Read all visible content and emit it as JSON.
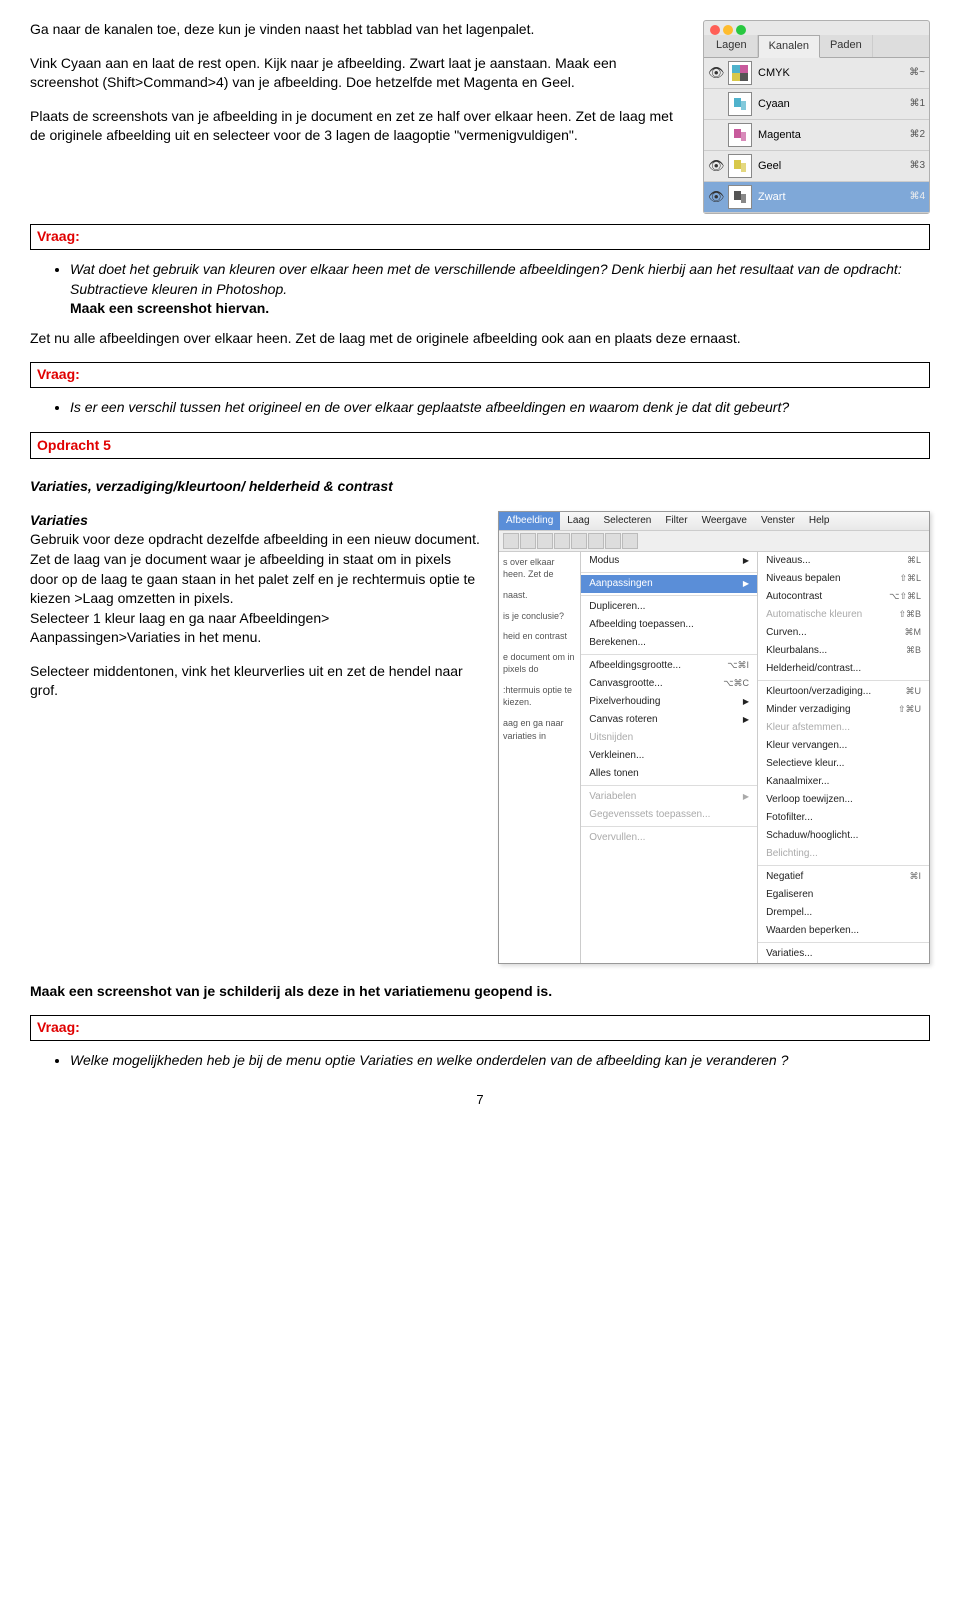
{
  "intro": {
    "p1": "Ga naar de kanalen toe, deze kun je vinden naast het tabblad van het lagenpalet.",
    "p2": "Vink Cyaan aan en laat de rest open. Kijk naar je afbeelding. Zwart laat je aanstaan. Maak een screenshot (Shift>Command>4) van je afbeelding. Doe hetzelfde met Magenta en Geel.",
    "p3": "Plaats de screenshots van je afbeelding in je document en zet ze half over elkaar heen. Zet de laag met de originele afbeelding uit en selecteer voor de 3 lagen de laagoptie \"vermenigvuldigen\"."
  },
  "channels_panel": {
    "tabs": [
      "Lagen",
      "Kanalen",
      "Paden"
    ],
    "rows": [
      {
        "label": "CMYK",
        "shortcut": "⌘~",
        "eye": true,
        "selected": false,
        "color": "mixed"
      },
      {
        "label": "Cyaan",
        "shortcut": "⌘1",
        "eye": false,
        "selected": false,
        "color": "#4fb2cc"
      },
      {
        "label": "Magenta",
        "shortcut": "⌘2",
        "eye": false,
        "selected": false,
        "color": "#c85a9c"
      },
      {
        "label": "Geel",
        "shortcut": "⌘3",
        "eye": true,
        "selected": false,
        "color": "#d8c84a"
      },
      {
        "label": "Zwart",
        "shortcut": "⌘4",
        "eye": true,
        "selected": true,
        "color": "#555"
      }
    ]
  },
  "vraag_label": "Vraag:",
  "vraag1": {
    "bullet_part1": "Wat doet het gebruik van kleuren over elkaar heen met de verschillende afbeeldingen? Denk hierbij aan het resultaat van de opdracht: Subtractieve kleuren in Photoshop.",
    "bullet_bold": "Maak een screenshot hiervan."
  },
  "mid_p": "Zet nu alle afbeeldingen over elkaar heen.  Zet de laag met de  originele afbeelding ook aan en plaats deze ernaast.",
  "vraag2_bullet": "Is er een verschil tussen het origineel en de over elkaar geplaatste afbeeldingen en waarom denk je dat dit gebeurt?",
  "opdracht5": "Opdracht 5",
  "sec_title": "Variaties, verzadiging/kleurtoon/  helderheid & contrast",
  "variaties": {
    "heading": "Variaties",
    "p1": "Gebruik voor deze opdracht dezelfde afbeelding in een nieuw document.",
    "p2": "Zet de laag van je document waar je afbeelding in staat om in pixels door op de laag te gaan staan in het palet zelf en je rechtermuis optie te kiezen >Laag omzetten in pixels.",
    "p3": "Selecteer 1 kleur laag en ga naar Afbeeldingen> Aanpassingen>Variaties in het menu.",
    "p4": "Selecteer middentonen, vink het kleurverlies uit en zet de hendel naar grof."
  },
  "menu": {
    "topbar": [
      "Afbeelding",
      "Laag",
      "Selecteren",
      "Filter",
      "Weergave",
      "Venster",
      "Help"
    ],
    "left": [
      {
        "label": "Modus",
        "arrow": true
      },
      {
        "sep": true
      },
      {
        "label": "Aanpassingen",
        "arrow": true,
        "sel": true
      },
      {
        "sep": true
      },
      {
        "label": "Dupliceren..."
      },
      {
        "label": "Afbeelding toepassen..."
      },
      {
        "label": "Berekenen..."
      },
      {
        "sep": true
      },
      {
        "label": "Afbeeldingsgrootte...",
        "shortcut": "⌥⌘I"
      },
      {
        "label": "Canvasgrootte...",
        "shortcut": "⌥⌘C"
      },
      {
        "label": "Pixelverhouding",
        "arrow": true
      },
      {
        "label": "Canvas roteren",
        "arrow": true
      },
      {
        "label": "Uitsnijden",
        "dis": true
      },
      {
        "label": "Verkleinen..."
      },
      {
        "label": "Alles tonen"
      },
      {
        "sep": true
      },
      {
        "label": "Variabelen",
        "arrow": true,
        "dis": true
      },
      {
        "label": "Gegevenssets toepassen...",
        "dis": true
      },
      {
        "sep": true
      },
      {
        "label": "Overvullen...",
        "dis": true
      }
    ],
    "right": [
      {
        "label": "Niveaus...",
        "shortcut": "⌘L"
      },
      {
        "label": "Niveaus bepalen",
        "shortcut": "⇧⌘L"
      },
      {
        "label": "Autocontrast",
        "shortcut": "⌥⇧⌘L"
      },
      {
        "label": "Automatische kleuren",
        "shortcut": "⇧⌘B",
        "dis": true
      },
      {
        "label": "Curven...",
        "shortcut": "⌘M"
      },
      {
        "label": "Kleurbalans...",
        "shortcut": "⌘B"
      },
      {
        "label": "Helderheid/contrast..."
      },
      {
        "sep": true
      },
      {
        "label": "Kleurtoon/verzadiging...",
        "shortcut": "⌘U"
      },
      {
        "label": "Minder verzadiging",
        "shortcut": "⇧⌘U"
      },
      {
        "label": "Kleur afstemmen...",
        "dis": true
      },
      {
        "label": "Kleur vervangen..."
      },
      {
        "label": "Selectieve kleur..."
      },
      {
        "label": "Kanaalmixer..."
      },
      {
        "label": "Verloop toewijzen..."
      },
      {
        "label": "Fotofilter..."
      },
      {
        "label": "Schaduw/hooglicht..."
      },
      {
        "label": "Belichting...",
        "dis": true
      },
      {
        "sep": true
      },
      {
        "label": "Negatief",
        "shortcut": "⌘I"
      },
      {
        "label": "Egaliseren"
      },
      {
        "label": "Drempel..."
      },
      {
        "label": "Waarden beperken..."
      },
      {
        "sep": true
      },
      {
        "label": "Variaties..."
      }
    ],
    "trunc": [
      "s over elkaar heen.  Zet de",
      "naast.",
      "is je conclusie?",
      "heid en contrast",
      "e document om in pixels do",
      ":htermuis optie te kiezen.",
      "aag en ga naar variaties in"
    ]
  },
  "bold_line": "Maak een screenshot van je schilderij als deze in het variatiemenu geopend is.",
  "vraag3_bullet": "Welke mogelijkheden heb je bij de menu optie Variaties en welke onderdelen van de afbeelding  kan je veranderen ?",
  "page": "7"
}
